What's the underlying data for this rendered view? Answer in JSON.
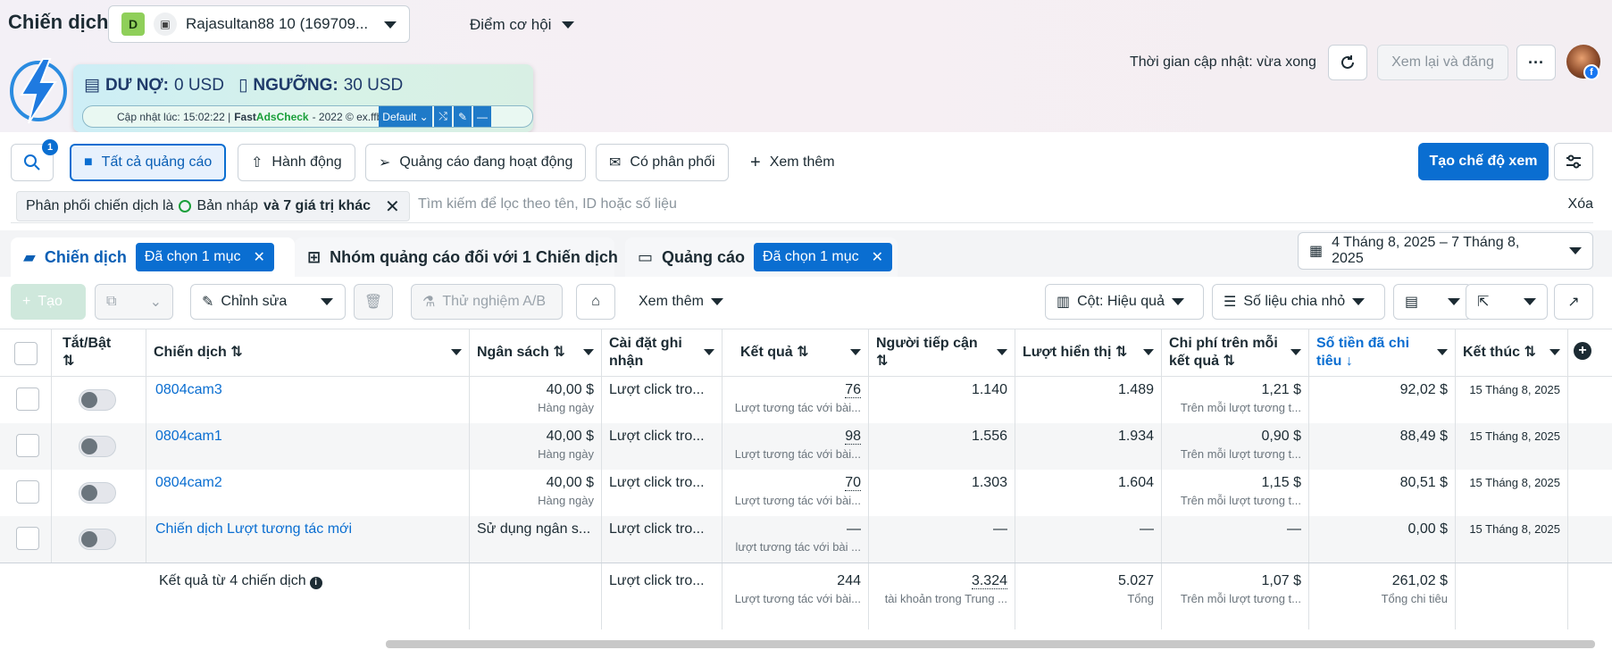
{
  "header": {
    "page_title": "Chiến dịch",
    "account": {
      "badge": "D",
      "name": "Rajasultan88 10 (169709..."
    },
    "opportunity": "Điểm cơ hội",
    "update_time": "Thời gian cập nhật: vừa xong",
    "review_publish": "Xem lại và đăng",
    "more": "···"
  },
  "extension": {
    "debt_label": "DƯ NỢ:",
    "debt_value": "0 USD",
    "threshold_label": "NGƯỠNG:",
    "threshold_value": "30 USD",
    "updated_at": "Cập nhật lúc: 15:02:22 |",
    "fast": "Fast",
    "adscheck": "AdsCheck",
    "copyright": "- 2022 © ex.ffb.vn",
    "profile": "Default"
  },
  "toolbar": {
    "search_badge": "1",
    "buttons": {
      "all_ads": "Tất cả quảng cáo",
      "actions": "Hành động",
      "active_ads": "Quảng cáo đang hoạt động",
      "delivering": "Có phân phối",
      "see_more": "Xem thêm"
    },
    "create_view": "Tạo chế độ xem"
  },
  "filter": {
    "chip_prefix": "Phân phối chiến dịch là",
    "chip_value": "Bản nháp",
    "chip_suffix": "và 7 giá trị khác",
    "placeholder": "Tìm kiếm để lọc theo tên, ID hoặc số liệu",
    "clear": "Xóa"
  },
  "tabs": {
    "campaigns": "Chiến dịch",
    "campaigns_selected": "Đã chọn 1 mục",
    "adsets": "Nhóm quảng cáo đối với 1 Chiến dịch",
    "ads": "Quảng cáo",
    "ads_selected": "Đã chọn 1 mục",
    "date_range": "4 Tháng 8, 2025 – 7 Tháng 8, 2025"
  },
  "actions": {
    "create": "Tạo",
    "edit": "Chỉnh sửa",
    "ab_test": "Thử nghiệm A/B",
    "see_more": "Xem thêm",
    "columns": "Cột: Hiệu quả",
    "breakdown": "Số liệu chia nhỏ"
  },
  "columns": {
    "toggle": "Tắt/Bật",
    "campaign": "Chiến dịch",
    "budget": "Ngân sách",
    "attribution": "Cài đặt ghi nhận",
    "results": "Kết quả",
    "reach": "Người tiếp cận",
    "impressions": "Lượt hiển thị",
    "cost_per_result": "Chi phí trên mỗi kết quả",
    "amount_spent": "Số tiền đã chi tiêu",
    "ends": "Kết thúc"
  },
  "rows": [
    {
      "name": "0804cam3",
      "budget": "40,00 $",
      "budget_sub": "Hàng ngày",
      "attribution": "Lượt click tro...",
      "results": "76",
      "results_sub": "Lượt tương tác với bài...",
      "reach": "1.140",
      "impressions": "1.489",
      "cpr": "1,21 $",
      "cpr_sub": "Trên mỗi lượt tương t...",
      "spent": "92,02 $",
      "ends": "15 Tháng 8, 2025"
    },
    {
      "name": "0804cam1",
      "budget": "40,00 $",
      "budget_sub": "Hàng ngày",
      "attribution": "Lượt click tro...",
      "results": "98",
      "results_sub": "Lượt tương tác với bài...",
      "reach": "1.556",
      "impressions": "1.934",
      "cpr": "0,90 $",
      "cpr_sub": "Trên mỗi lượt tương t...",
      "spent": "88,49 $",
      "ends": "15 Tháng 8, 2025"
    },
    {
      "name": "0804cam2",
      "budget": "40,00 $",
      "budget_sub": "Hàng ngày",
      "attribution": "Lượt click tro...",
      "results": "70",
      "results_sub": "Lượt tương tác với bài...",
      "reach": "1.303",
      "impressions": "1.604",
      "cpr": "1,15 $",
      "cpr_sub": "Trên mỗi lượt tương t...",
      "spent": "80,51 $",
      "ends": "15 Tháng 8, 2025"
    },
    {
      "name": "Chiến dịch Lượt tương tác mới",
      "budget": "Sử dụng ngân s...",
      "budget_sub": "",
      "attribution": "Lượt click tro...",
      "results": "—",
      "results_sub": "lượt tương tác với bài ...",
      "reach": "—",
      "impressions": "—",
      "cpr": "—",
      "cpr_sub": "",
      "spent": "0,00 $",
      "ends": "15 Tháng 8, 2025"
    }
  ],
  "totals": {
    "label": "Kết quả từ 4 chiến dịch",
    "attribution": "Lượt click tro...",
    "results": "244",
    "results_sub": "Lượt tương tác với bài...",
    "reach": "3.324",
    "reach_sub": "tài khoản trong Trung ...",
    "impressions": "5.027",
    "impressions_sub": "Tổng",
    "cpr": "1,07 $",
    "cpr_sub": "Trên mỗi lượt tương t...",
    "spent": "261,02 $",
    "spent_sub": "Tổng chi tiêu"
  }
}
